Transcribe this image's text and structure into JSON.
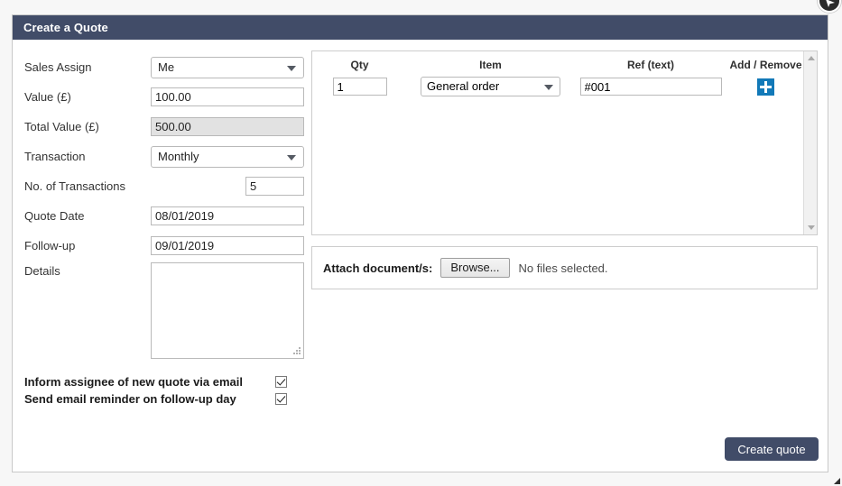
{
  "window": {
    "title": "Create a Quote",
    "header_bg": "#414c68",
    "accent_blue": "#1279b8"
  },
  "form": {
    "fields": [
      {
        "label": "Sales Assign",
        "type": "select",
        "value": "Me"
      },
      {
        "label": "Value (£)",
        "type": "text",
        "value": "100.00"
      },
      {
        "label": "Total Value (£)",
        "type": "readonly",
        "value": "500.00"
      },
      {
        "label": "Transaction",
        "type": "select",
        "value": "Monthly"
      },
      {
        "label": "No. of Transactions",
        "type": "number",
        "value": "5"
      },
      {
        "label": "Quote Date",
        "type": "date",
        "value": "08/01/2019"
      },
      {
        "label": "Follow-up",
        "type": "date",
        "value": "09/01/2019"
      }
    ],
    "details": {
      "label": "Details",
      "value": "",
      "placeholder": ""
    },
    "checkboxes": [
      {
        "label": "Inform assignee of new quote via email",
        "checked": true
      },
      {
        "label": "Send email reminder on follow-up day",
        "checked": true
      }
    ]
  },
  "items": {
    "columns": [
      "Qty",
      "Item",
      "Ref (text)",
      "Add / Remove"
    ],
    "rows": [
      {
        "qty": "1",
        "item": "General order",
        "ref": "#001",
        "action_icon": "plus-icon"
      }
    ]
  },
  "attach": {
    "label": "Attach document/s:",
    "browse_label": "Browse...",
    "status": "No files selected."
  },
  "footer": {
    "submit_label": "Create quote"
  }
}
